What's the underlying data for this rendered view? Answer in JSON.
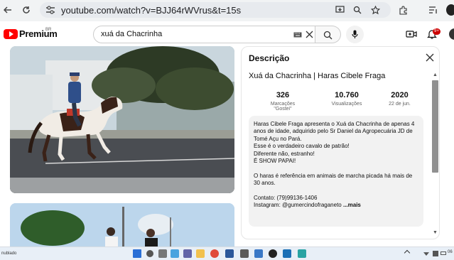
{
  "browser": {
    "url": "youtube.com/watch?v=BJJ64rWVrus&t=15s"
  },
  "youtube": {
    "brand": "Premium",
    "country": "BR",
    "search_query": "xuá da Chacrinha",
    "notification_badge": "9+"
  },
  "description_panel": {
    "heading": "Descrição",
    "video_title": "Xuá da Chacrinha | Haras Cibele Fraga",
    "stats": [
      {
        "value": "326",
        "label": "Marcações \"Gostei\""
      },
      {
        "value": "10.760",
        "label": "Visualizações"
      },
      {
        "value": "2020",
        "label": "22 de jun."
      }
    ],
    "body": "Haras Cibele Fraga apresenta o Xuá da Chacrinha de apenas 4 anos de idade, adquirido pelo Sr Daniel da Agropecuária JD de Tomé Açu no Pará.\nEsse é o verdadeiro cavalo de patrão!\nDiferente não, estranho!\nÉ SHOW PAPAI!\n\nO haras é referência em animais de marcha picada há mais de 30 anos.\n\nContato: (79)99136-1406\nInstagram: @gumercindofraganeto ",
    "more_label": "...mais"
  },
  "taskbar": {
    "weather": "nublado",
    "time": "06"
  },
  "colors": {
    "youtube_red": "#ff0000",
    "badge_red": "#cc0000",
    "chrome_bg": "#f1f3f4",
    "desc_box_bg": "#f2f2f2"
  }
}
